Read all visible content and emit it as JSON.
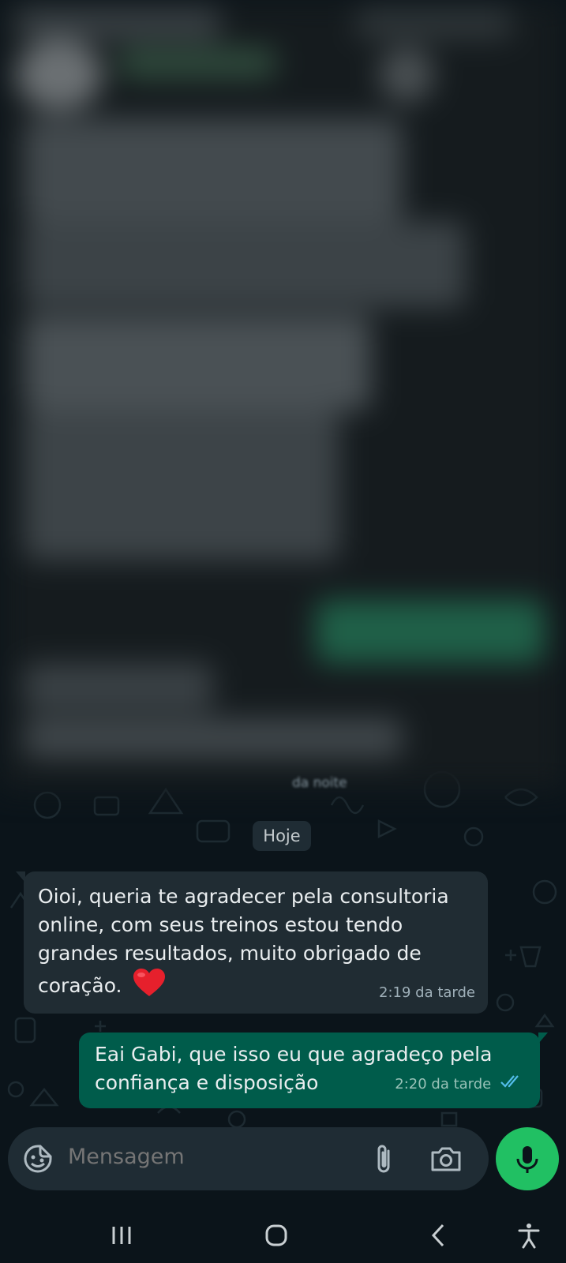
{
  "chat": {
    "blurred_partial_time": "da noite",
    "date_divider": "Hoje",
    "messages": [
      {
        "direction": "incoming",
        "text": "Oioi, queria te agradecer pela consultoria online, com seus treinos estou tendo grandes resultados, muito obrigado de coração.",
        "line1": "Oioi, queria te agradecer pela consultoria",
        "line2": "online, com seus treinos estou tendo",
        "line3": "grandes resultados, muito obrigado de",
        "line4": "coração.",
        "emoji": "red-heart",
        "time": "2:19 da tarde"
      },
      {
        "direction": "outgoing",
        "line1": "Eai Gabi, que isso eu que agradeço pela",
        "line2": "confiança e disposição",
        "time": "2:20 da tarde",
        "status_icon": "double-check-read-icon"
      }
    ]
  },
  "composer": {
    "placeholder": "Mensagem",
    "emoji_icon": "sticker-icon",
    "attach_icon": "paperclip-icon",
    "camera_icon": "camera-icon",
    "send_icon": "microphone-icon"
  },
  "colors": {
    "background": "#0b141a",
    "incoming_bubble": "#202c33",
    "outgoing_bubble": "#005c4b",
    "accent": "#21c063",
    "read_ticks": "#53bdeb"
  },
  "system_nav": {
    "icons": [
      "recent-apps-icon",
      "home-icon",
      "back-icon",
      "accessibility-icon"
    ]
  }
}
